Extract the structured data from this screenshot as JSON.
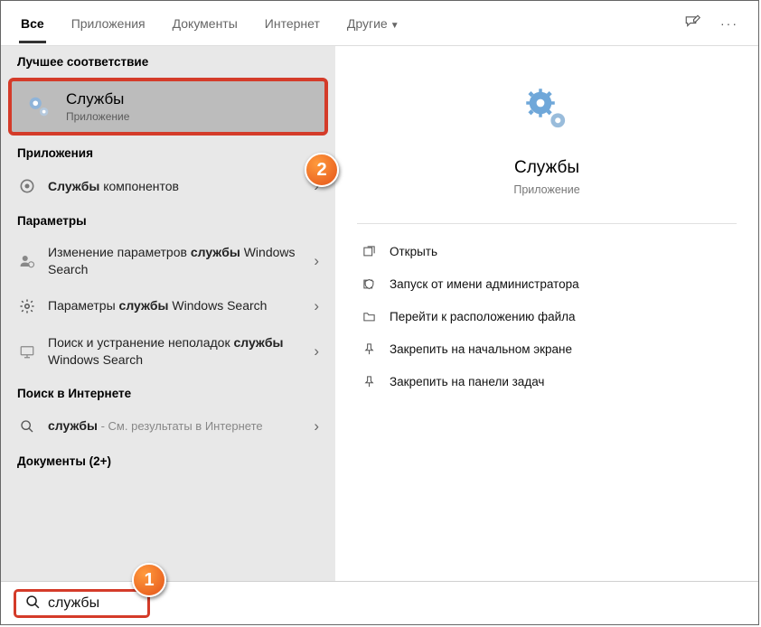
{
  "tabs": {
    "all": "Все",
    "apps": "Приложения",
    "docs": "Документы",
    "internet": "Интернет",
    "other": "Другие"
  },
  "sections": {
    "best_match": "Лучшее соответствие",
    "apps": "Приложения",
    "settings": "Параметры",
    "internet": "Поиск в Интернете",
    "documents": "Документы (2+)"
  },
  "best": {
    "title": "Службы",
    "subtitle": "Приложение"
  },
  "results": {
    "apps": [
      {
        "prefix": "",
        "bold": "Службы",
        "suffix": " компонентов"
      }
    ],
    "settings": [
      {
        "prefix": "Изменение параметров ",
        "bold": "службы",
        "suffix": " Windows Search"
      },
      {
        "prefix": "Параметры ",
        "bold": "службы",
        "suffix": " Windows Search"
      },
      {
        "prefix": "Поиск и устранение неполадок ",
        "bold": "службы",
        "suffix": " Windows Search"
      }
    ],
    "internet": {
      "bold": "службы",
      "suffix": " - См. результаты в Интернете"
    }
  },
  "detail": {
    "title": "Службы",
    "subtitle": "Приложение",
    "actions": {
      "open": "Открыть",
      "run_as_admin": "Запуск от имени администратора",
      "file_location": "Перейти к расположению файла",
      "pin_start": "Закрепить на начальном экране",
      "pin_taskbar": "Закрепить на панели задач"
    }
  },
  "search": {
    "value": "службы"
  },
  "badges": {
    "one": "1",
    "two": "2"
  }
}
